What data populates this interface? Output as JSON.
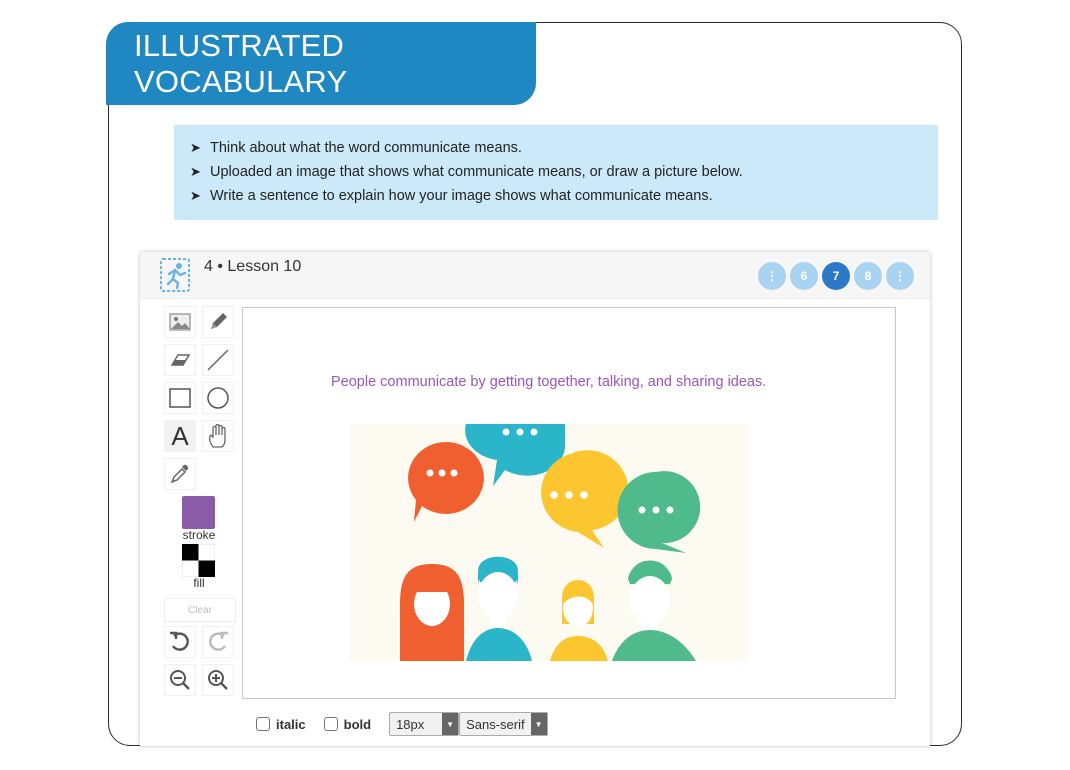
{
  "banner": {
    "title": "ILLUSTRATED VOCABULARY"
  },
  "instructions": [
    "Think about what the word communicate means.",
    "Uploaded an image that shows what communicate means, or draw a picture below.",
    "Write a sentence to explain how your image shows what communicate means."
  ],
  "instruction_bullet": "➤",
  "app": {
    "lesson_label": "4 • Lesson 10",
    "pages": [
      {
        "label": "⋮",
        "active": false
      },
      {
        "label": "6",
        "active": false
      },
      {
        "label": "7",
        "active": true
      },
      {
        "label": "8",
        "active": false
      },
      {
        "label": "⋮",
        "active": false
      }
    ],
    "tools": [
      {
        "icon": "image-icon"
      },
      {
        "icon": "pencil-icon"
      },
      {
        "icon": "eraser-icon"
      },
      {
        "icon": "line-icon"
      },
      {
        "icon": "rectangle-icon"
      },
      {
        "icon": "circle-icon"
      },
      {
        "icon": "text-icon",
        "label": "A",
        "selected": true
      },
      {
        "icon": "hand-icon"
      },
      {
        "icon": "eyedropper-icon"
      }
    ],
    "stroke_label": "stroke",
    "fill_label": "fill",
    "stroke_color": "#8a5ca8",
    "clear_label": "Clear",
    "canvas_caption": "People communicate by getting together, talking, and sharing ideas.",
    "format": {
      "italic_label": "italic",
      "bold_label": "bold",
      "size_value": "18px",
      "font_value": "Sans-serif"
    }
  },
  "colors": {
    "banner": "#1f88c2",
    "instructions_bg": "#cce9fa",
    "caption": "#9a55b8",
    "page_active": "#2a78c7",
    "page_inactive": "#a9d3f1"
  }
}
